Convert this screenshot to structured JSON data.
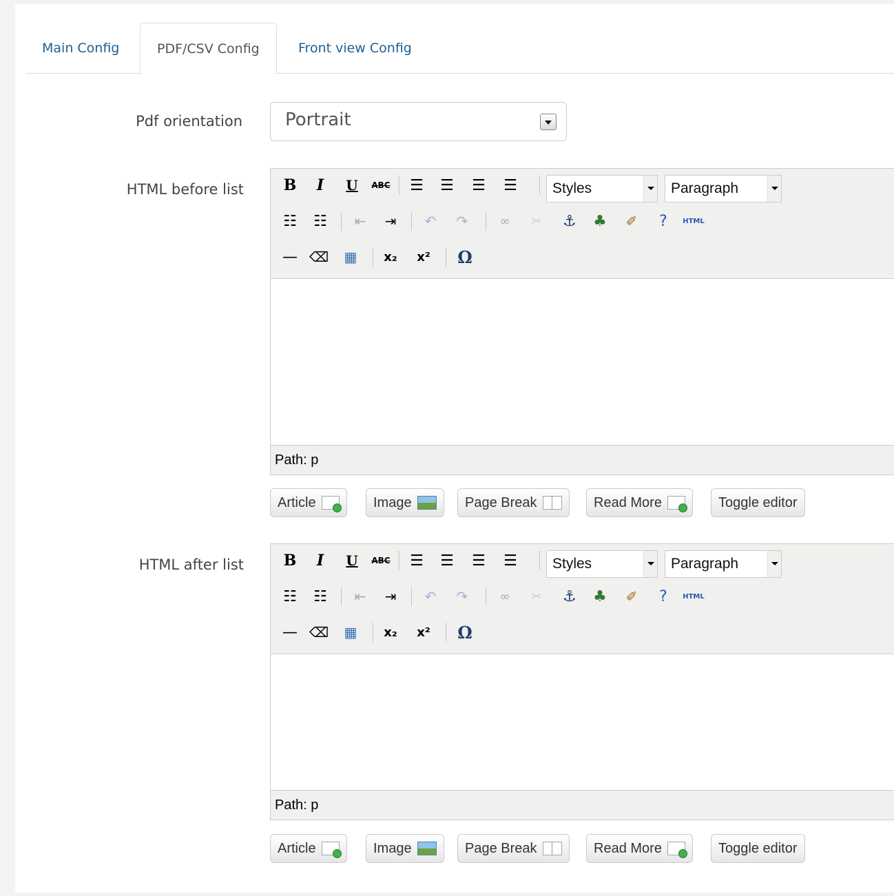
{
  "tabs": [
    {
      "label": "Main Config",
      "active": false
    },
    {
      "label": "PDF/CSV Config",
      "active": true
    },
    {
      "label": "Front view Config",
      "active": false
    }
  ],
  "fields": {
    "pdf_orientation": {
      "label": "Pdf orientation",
      "value": "Portrait"
    },
    "html_before": {
      "label": "HTML before list"
    },
    "html_after": {
      "label": "HTML after list"
    }
  },
  "editor": {
    "styles_label": "Styles",
    "format_label": "Paragraph",
    "path_label": "Path: p",
    "html_icon_text": "HTML",
    "omega_glyph": "Ω"
  },
  "editor_buttons": {
    "article": "Article",
    "image": "Image",
    "page_break": "Page Break",
    "read_more": "Read More",
    "toggle": "Toggle editor"
  }
}
